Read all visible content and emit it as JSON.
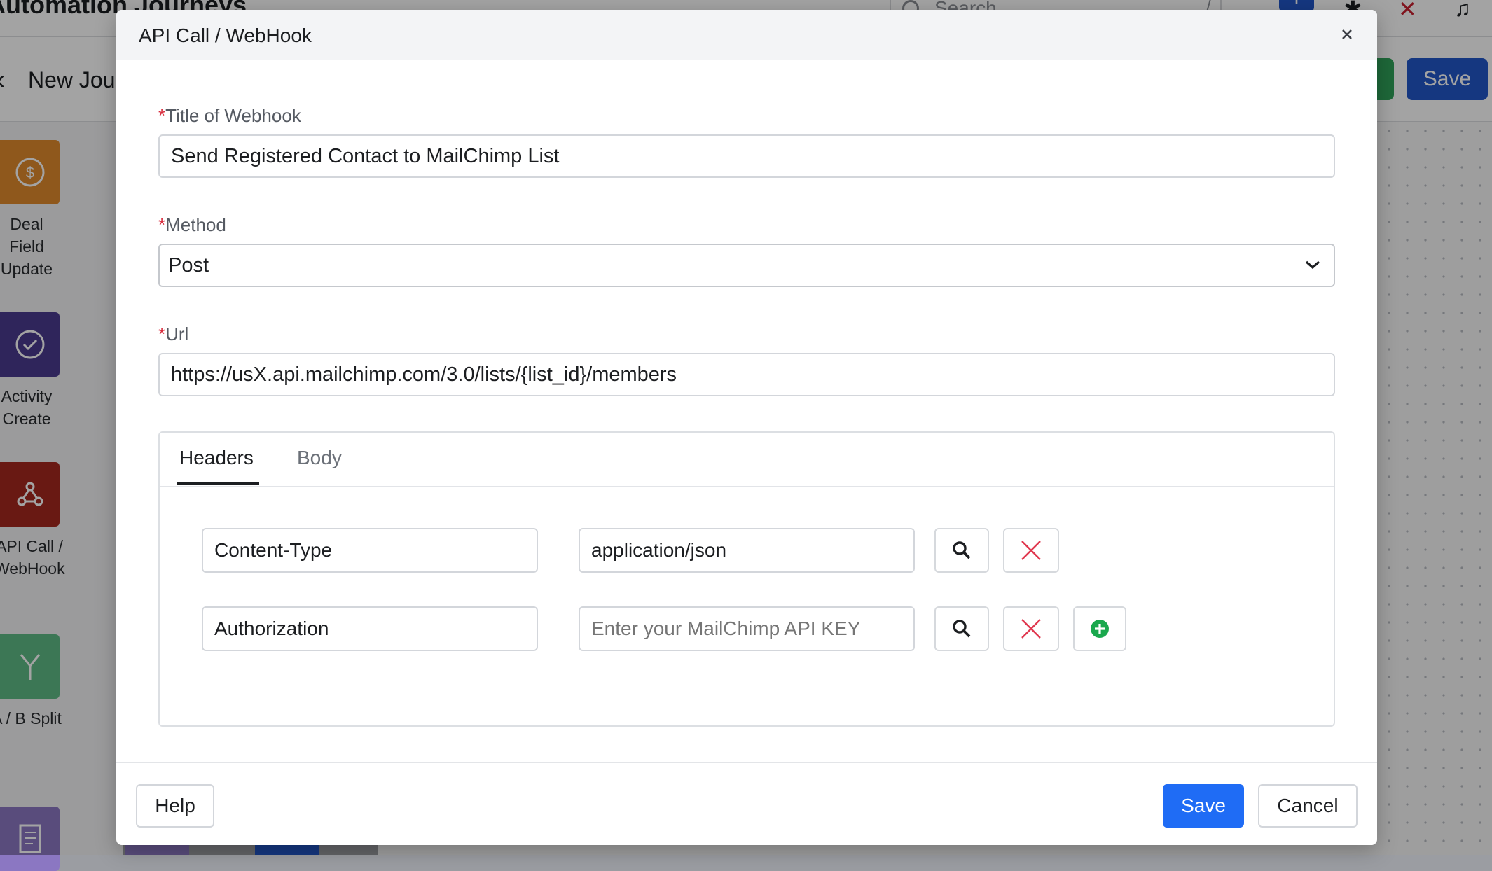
{
  "background": {
    "app_title": "Automation Journeys",
    "search_placeholder": "Search",
    "search_shortcut": "/",
    "journey_title": "New Jou",
    "save_label": "Save",
    "sidebar_tiles": [
      {
        "label": "Deal Field Update",
        "color": "#e08a2c",
        "icon": "dollar-icon"
      },
      {
        "label": "Activity Create",
        "color": "#4a3a8f",
        "icon": "check-circle-icon"
      },
      {
        "label": "API Call / WebHook",
        "color": "#a5281f",
        "icon": "webhook-icon"
      },
      {
        "label": "A / B Split",
        "color": "#5fbb86",
        "icon": "split-icon"
      },
      {
        "label": "",
        "color": "#8b77c2",
        "icon": "document-icon"
      }
    ]
  },
  "modal": {
    "title": "API Call / WebHook",
    "fields": {
      "title": {
        "label": "Title of Webhook",
        "value": "Send Registered Contact to MailChimp List"
      },
      "method": {
        "label": "Method",
        "value": "Post"
      },
      "url": {
        "label": "Url",
        "value": "https://usX.api.mailchimp.com/3.0/lists/{list_id}/members"
      }
    },
    "tabs": [
      {
        "label": "Headers",
        "active": true
      },
      {
        "label": "Body",
        "active": false
      }
    ],
    "headers": [
      {
        "key": "Content-Type",
        "value": "application/json"
      },
      {
        "key": "Authorization",
        "value": "Enter your MailChimp API KEY"
      }
    ],
    "footer": {
      "help": "Help",
      "save": "Save",
      "cancel": "Cancel"
    }
  },
  "colors": {
    "primary": "#1f6cf5",
    "required": "#d92d3e",
    "remove": "#e0384f",
    "add": "#1aa84d"
  }
}
